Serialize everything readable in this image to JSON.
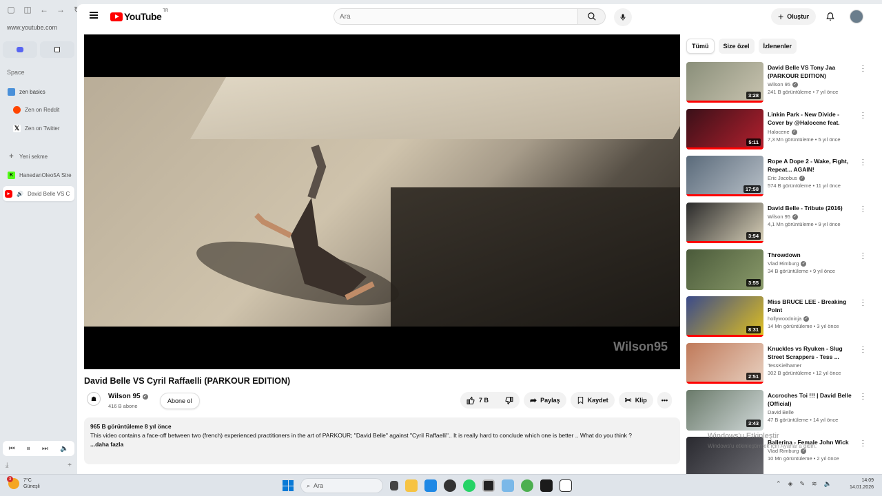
{
  "browser": {
    "url": "www.youtube.com",
    "space_label": "Space",
    "folder_label": "zen basics",
    "items": [
      {
        "label": "Zen on Reddit",
        "icon": "reddit-icon",
        "color": "#ff4500"
      },
      {
        "label": "Zen on Twitter",
        "icon": "x-icon",
        "color": "#111111"
      }
    ],
    "new_tab_label": "Yeni sekme",
    "tabs": [
      {
        "label": "HanedanOleo5A Stre",
        "icon": "kick-icon",
        "color": "#53fc18"
      },
      {
        "label": "David Belle VS C",
        "icon": "youtube-icon",
        "color": "#ff0000",
        "active": true
      }
    ]
  },
  "header": {
    "logo_text": "YouTube",
    "country": "TR",
    "search_placeholder": "Ara",
    "create_label": "Oluştur"
  },
  "player": {
    "watermark": "Wilson95"
  },
  "video": {
    "title": "David Belle VS Cyril Raffaelli (PARKOUR EDITION)",
    "channel": "Wilson 95",
    "subscribers": "416 B abone",
    "subscribe_label": "Abone ol",
    "likes": "7 B",
    "share_label": "Paylaş",
    "save_label": "Kaydet",
    "clip_label": "Klip",
    "meta": "965 B görüntüleme  8 yıl önce",
    "description": "This video contains a face-off between two (french) experienced practitioners in the art of PARKOUR;  \"David Belle\" against \"Cyril Raffaelli\".. It is really hard to conclude which one is better .. What do you think ?",
    "more_label": "...daha fazla"
  },
  "chips": [
    "Tümü",
    "Size özel",
    "İzlenenler"
  ],
  "recommendations": [
    {
      "title": "David Belle VS Tony Jaa (PARKOUR EDITION)",
      "channel": "Wilson 95",
      "verified": true,
      "views": "241 B görüntüleme • 7 yıl önce",
      "duration": "3:28",
      "watched": 1.0,
      "colors": [
        "#8a8f7a",
        "#c9c4b0"
      ]
    },
    {
      "title": "Linkin Park - New Divide - Cover by @Halocene feat. @Violet ...",
      "channel": "Halocene",
      "verified": true,
      "views": "7,3 Mn görüntüleme • 5 yıl önce",
      "duration": "5:11",
      "watched": 1.0,
      "colors": [
        "#3a1018",
        "#b3202e"
      ]
    },
    {
      "title": "Rope A Dope 2 - Wake, Fight, Repeat... AGAIN!",
      "channel": "Eric Jacobus",
      "verified": true,
      "views": "574 B görüntüleme • 11 yıl önce",
      "duration": "17:58",
      "watched": 1.0,
      "colors": [
        "#5a6a7a",
        "#b8c0c8"
      ]
    },
    {
      "title": "David Belle - Tribute (2016)",
      "channel": "Wilson 95",
      "verified": true,
      "views": "4,1 Mn görüntüleme • 9 yıl önce",
      "duration": "3:54",
      "watched": 1.0,
      "colors": [
        "#2a2a2a",
        "#d8d0b8"
      ]
    },
    {
      "title": "Throwdown",
      "channel": "Vlad Rimburg",
      "verified": true,
      "views": "34 B görüntüleme • 9 yıl önce",
      "duration": "3:55",
      "watched": 0.0,
      "colors": [
        "#4a5a3a",
        "#8a9a6a"
      ]
    },
    {
      "title": "Miss BRUCE LEE - Breaking Point",
      "channel": "hollywoodninja",
      "verified": true,
      "views": "14 Mn görüntüleme • 3 yıl önce",
      "duration": "8:31",
      "watched": 1.0,
      "colors": [
        "#3a4a8a",
        "#e0c020"
      ]
    },
    {
      "title": "Knuckles vs Ryuken - Slug Street Scrappers - Tess ...",
      "channel": "TessKielhamer",
      "verified": false,
      "views": "302 B görüntüleme • 12 yıl önce",
      "duration": "2:51",
      "watched": 1.0,
      "colors": [
        "#c07a5a",
        "#e8d0c0"
      ]
    },
    {
      "title": "Accroches Toi !!! | David Belle (Official)",
      "channel": "David Belle",
      "verified": false,
      "views": "47 B görüntüleme • 14 yıl önce",
      "duration": "3:43",
      "watched": 0.0,
      "colors": [
        "#6a7a6a",
        "#d0d8d8"
      ]
    },
    {
      "title": "Ballerina - Female John Wick",
      "channel": "Vlad Rimburg",
      "verified": true,
      "views": "10 Mn görüntüleme • 2 yıl önce",
      "duration": "",
      "watched": 0.0,
      "colors": [
        "#2a2a30",
        "#6a6a70"
      ]
    }
  ],
  "windows_activation": {
    "title": "Windows'u Etkinleştir",
    "subtitle": "Windows'u etkinleştirmek için Ayarlar'a gidin."
  },
  "taskbar": {
    "weather_temp": "7°C",
    "weather_desc": "Güneşli",
    "weather_badge": "3",
    "search_placeholder": "Ara",
    "time": "14:09",
    "date": "14.01.2026"
  }
}
